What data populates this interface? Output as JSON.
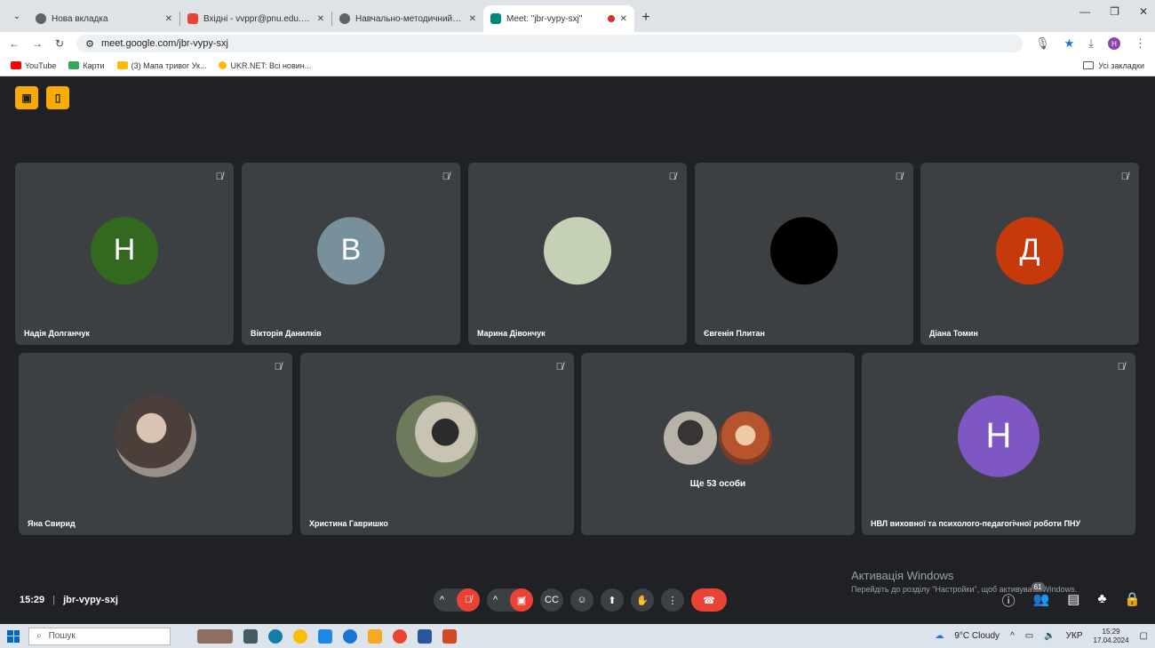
{
  "browser": {
    "tabs": [
      {
        "title": "Нова вкладка",
        "active": false,
        "favicon_color": "#5f6368"
      },
      {
        "title": "Вхідні - vvppr@pnu.edu.ua - П",
        "active": false,
        "favicon_color": "#ea4335"
      },
      {
        "title": "Навчально-методичний семі",
        "active": false,
        "favicon_color": "#5f6368"
      },
      {
        "title": "Meet: \"jbr-vypy-sxj\"",
        "active": true,
        "favicon_color": "#00897b"
      }
    ],
    "url": "meet.google.com/jbr-vypy-sxj",
    "profile_initial": "H",
    "bookmarks": [
      {
        "label": "YouTube",
        "color": "#ff0000"
      },
      {
        "label": "Карти",
        "color": "#34a853"
      },
      {
        "label": "(3) Мапа тривог Ук...",
        "color": "#fbbc04"
      },
      {
        "label": "UKR.NET: Всі новин...",
        "color": "#fbbc04"
      }
    ],
    "all_bookmarks_label": "Усі закладки"
  },
  "meet": {
    "top_badges": [
      "videocam-off-icon",
      "door-icon"
    ],
    "tiles_row1": [
      {
        "name": "Надія Долганчук",
        "initial": "Н",
        "color": "#33691e"
      },
      {
        "name": "Вікторія Данилків",
        "initial": "В",
        "color": "#78909c"
      },
      {
        "name": "Марина Дівончук",
        "initial": "",
        "color": "#c5d1b5"
      },
      {
        "name": "Євгенія Плитан",
        "initial": "",
        "color": "#000000"
      },
      {
        "name": "Діана Томин",
        "initial": "Д",
        "color": "#c5390a"
      }
    ],
    "tiles_row2": [
      {
        "name": "Яна Свирид",
        "photo_color": "#6d6560"
      },
      {
        "name": "Христина Гавришко",
        "photo_color": "#8a8f7a"
      },
      {
        "name": "",
        "more_text": "Ще 53 особи"
      },
      {
        "name": "НВЛ виховної та психолого-педагогічної роботи ПНУ",
        "initial": "Н",
        "color": "#7e57c2"
      }
    ],
    "time": "15:29",
    "separator": "|",
    "meeting_code": "jbr-vypy-sxj",
    "people_count": "61",
    "watermark_title": "Активація Windows",
    "watermark_sub": "Перейдіть до розділу \"Настройки\", щоб активувати Windows."
  },
  "taskbar": {
    "search_placeholder": "Пошук",
    "weather": "9°C  Cloudy",
    "lang": "УКР",
    "time": "15:29",
    "date": "17.04.2024"
  }
}
